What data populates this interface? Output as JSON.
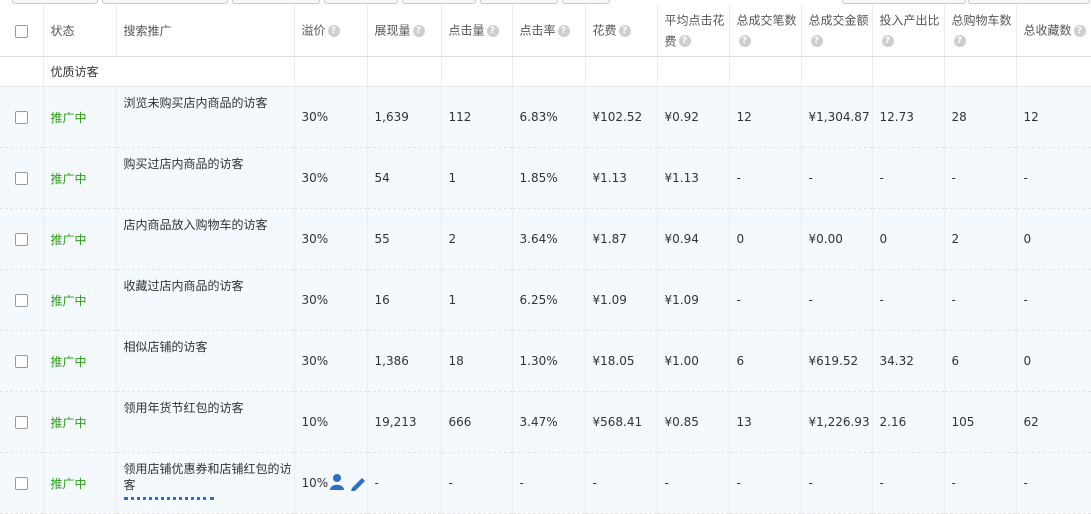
{
  "columns": {
    "status": "状态",
    "search_promo": "搜索推广",
    "premium": "溢价",
    "impressions": "展现量",
    "clicks": "点击量",
    "ctr": "点击率",
    "cost": "花费",
    "avg_cpc": "平均点击花费",
    "total_orders": "总成交笔数",
    "total_gmv": "总成交金额",
    "roi": "投入产出比",
    "cart": "总购物车数",
    "favorites": "总收藏数"
  },
  "help_glyph": "?",
  "group_label": "优质访客",
  "rows": [
    {
      "status": "推广中",
      "name": "浏览未购买店内商品的访客",
      "premium": "30%",
      "impressions": "1,639",
      "clicks": "112",
      "ctr": "6.83%",
      "cost": "¥102.52",
      "avg_cpc": "¥0.92",
      "orders": "12",
      "gmv": "¥1,304.87",
      "roi": "12.73",
      "cart": "28",
      "fav": "12"
    },
    {
      "status": "推广中",
      "name": "购买过店内商品的访客",
      "premium": "30%",
      "impressions": "54",
      "clicks": "1",
      "ctr": "1.85%",
      "cost": "¥1.13",
      "avg_cpc": "¥1.13",
      "orders": "-",
      "gmv": "-",
      "roi": "-",
      "cart": "-",
      "fav": "-"
    },
    {
      "status": "推广中",
      "name": "店内商品放入购物车的访客",
      "premium": "30%",
      "impressions": "55",
      "clicks": "2",
      "ctr": "3.64%",
      "cost": "¥1.87",
      "avg_cpc": "¥0.94",
      "orders": "0",
      "gmv": "¥0.00",
      "roi": "0",
      "cart": "2",
      "fav": "0"
    },
    {
      "status": "推广中",
      "name": "收藏过店内商品的访客",
      "premium": "30%",
      "impressions": "16",
      "clicks": "1",
      "ctr": "6.25%",
      "cost": "¥1.09",
      "avg_cpc": "¥1.09",
      "orders": "-",
      "gmv": "-",
      "roi": "-",
      "cart": "-",
      "fav": "-"
    },
    {
      "status": "推广中",
      "name": "相似店铺的访客",
      "premium": "30%",
      "impressions": "1,386",
      "clicks": "18",
      "ctr": "1.30%",
      "cost": "¥18.05",
      "avg_cpc": "¥1.00",
      "orders": "6",
      "gmv": "¥619.52",
      "roi": "34.32",
      "cart": "6",
      "fav": "0"
    },
    {
      "status": "推广中",
      "name": "领用年货节红包的访客",
      "premium": "10%",
      "impressions": "19,213",
      "clicks": "666",
      "ctr": "3.47%",
      "cost": "¥568.41",
      "avg_cpc": "¥0.85",
      "orders": "13",
      "gmv": "¥1,226.93",
      "roi": "2.16",
      "cart": "105",
      "fav": "62"
    },
    {
      "status": "推广中",
      "name": "领用店铺优惠券和店铺红包的访客",
      "premium": "10%",
      "impressions": "-",
      "clicks": "-",
      "ctr": "-",
      "cost": "-",
      "avg_cpc": "-",
      "orders": "-",
      "gmv": "-",
      "roi": "-",
      "cart": "-",
      "fav": "-"
    }
  ],
  "colors": {
    "status_green": "#2e9e16",
    "row_bg": "#f3f9fd",
    "edit_blue": "#2a6fc9"
  },
  "icons": {
    "help": "help-circle-icon",
    "edit": "pencil-icon",
    "person": "user-icon"
  }
}
